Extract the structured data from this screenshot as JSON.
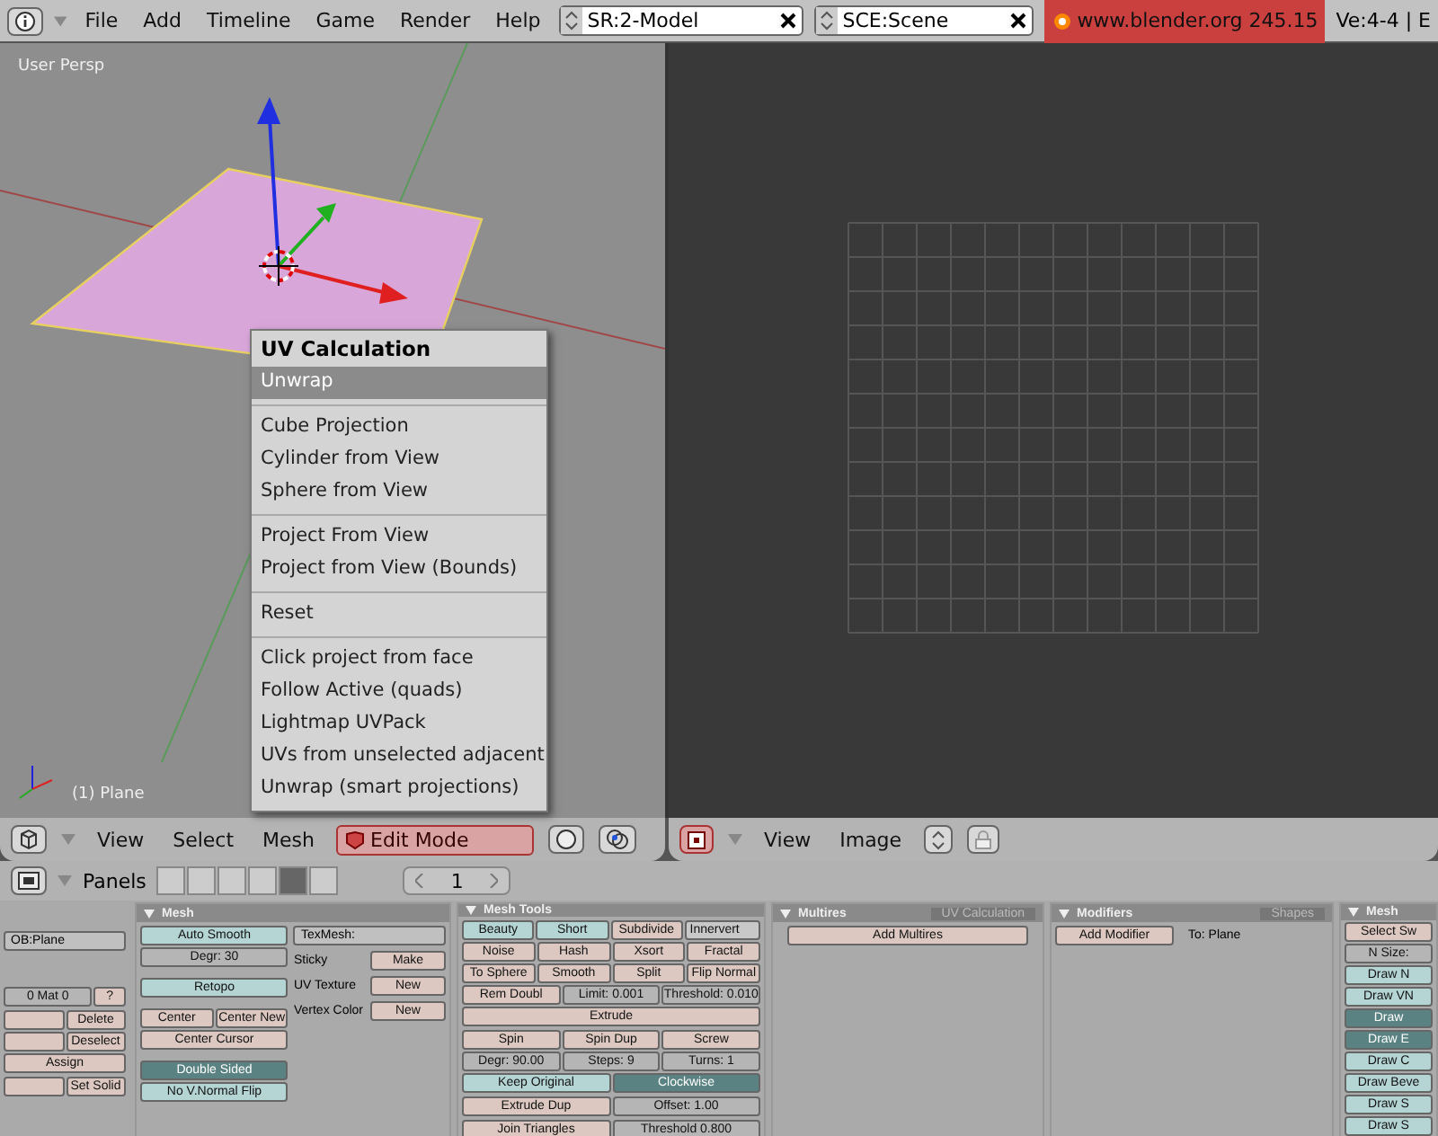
{
  "top_bar": {
    "menus": [
      "File",
      "Add",
      "Timeline",
      "Game",
      "Render",
      "Help"
    ],
    "screen": "SR:2-Model",
    "scene": "SCE:Scene",
    "version": "www.blender.org 245.15",
    "stats": "Ve:4-4 | E"
  },
  "viewport_3d": {
    "view_label": "User Persp",
    "object_label": "(1) Plane"
  },
  "uv_menu": {
    "title": "UV Calculation",
    "groups": [
      [
        {
          "label": "Unwrap",
          "selected": true
        }
      ],
      [
        {
          "label": "Cube Projection",
          "selected": false
        },
        {
          "label": "Cylinder from View",
          "selected": false
        },
        {
          "label": "Sphere from View",
          "selected": false
        }
      ],
      [
        {
          "label": "Project From View",
          "selected": false
        },
        {
          "label": "Project from View (Bounds)",
          "selected": false
        }
      ],
      [
        {
          "label": "Reset",
          "selected": false
        }
      ],
      [
        {
          "label": "Click project from face",
          "selected": false
        },
        {
          "label": "Follow Active (quads)",
          "selected": false
        },
        {
          "label": "Lightmap UVPack",
          "selected": false
        },
        {
          "label": "UVs from unselected adjacent",
          "selected": false
        },
        {
          "label": "Unwrap (smart projections)",
          "selected": false
        }
      ]
    ]
  },
  "header_3d": {
    "menus": [
      "View",
      "Select",
      "Mesh"
    ],
    "mode": "Edit Mode"
  },
  "header_uv": {
    "menus": [
      "View",
      "Image"
    ]
  },
  "buttons_header": {
    "label": "Panels",
    "context_tabs": [
      {
        "selected": false
      },
      {
        "selected": false
      },
      {
        "selected": false
      },
      {
        "selected": false
      },
      {
        "selected": true
      },
      {
        "selected": false
      }
    ],
    "frame": "1"
  },
  "link_panel": {
    "object": "OB:Plane",
    "material": "0 Mat 0",
    "help": "?",
    "groups": [
      [
        [
          {
            "kind": "action"
          },
          {
            "kind": "action",
            "label": "Delete"
          }
        ],
        [
          {
            "kind": "action"
          },
          {
            "kind": "action",
            "label": "Deselect"
          }
        ],
        [
          {
            "kind": "action",
            "label": "Assign"
          }
        ]
      ],
      [
        [
          {
            "kind": "action"
          },
          {
            "kind": "action",
            "label": "Set Solid"
          }
        ]
      ]
    ]
  },
  "mesh_panel": {
    "title": "Mesh",
    "groups": [
      [
        [
          {
            "kind": "toggle",
            "label": "Auto Smooth",
            "on": false
          }
        ],
        [
          {
            "kind": "number",
            "label": "Degr: 30"
          }
        ]
      ],
      [
        [
          {
            "kind": "toggle",
            "label": "Retopo",
            "on": false
          }
        ]
      ],
      [
        [
          {
            "kind": "action",
            "label": "Center"
          },
          {
            "kind": "action",
            "label": "Center New"
          }
        ],
        [
          {
            "kind": "action",
            "label": "Center Cursor"
          }
        ]
      ],
      [
        [
          {
            "kind": "toggle",
            "label": "Double Sided",
            "on": true
          }
        ],
        [
          {
            "kind": "toggle",
            "label": "No V.Normal Flip",
            "on": false
          }
        ]
      ]
    ],
    "texmesh": "TexMesh:",
    "layers": [
      {
        "label": "Sticky",
        "button": "Make"
      },
      {
        "label": "UV Texture",
        "button": "New"
      },
      {
        "label": "Vertex Color",
        "button": "New"
      }
    ]
  },
  "mesh_tools_panel": {
    "title": "Mesh Tools",
    "groups": [
      [
        [
          {
            "kind": "toggle",
            "label": "Beauty",
            "on": false
          },
          {
            "kind": "toggle",
            "label": "Short",
            "on": false
          },
          {
            "kind": "action",
            "label": "Subdivide"
          },
          {
            "kind": "menu",
            "label": "Innervert"
          }
        ],
        [
          {
            "kind": "action",
            "label": "Noise"
          },
          {
            "kind": "action",
            "label": "Hash"
          },
          {
            "kind": "action",
            "label": "Xsort"
          },
          {
            "kind": "action",
            "label": "Fractal"
          }
        ],
        [
          {
            "kind": "action",
            "label": "To Sphere"
          },
          {
            "kind": "action",
            "label": "Smooth"
          },
          {
            "kind": "action",
            "label": "Split"
          },
          {
            "kind": "action",
            "label": "Flip Normal"
          }
        ],
        [
          {
            "kind": "action",
            "label": "Rem Doubl"
          },
          {
            "kind": "number",
            "label": "Limit: 0.001"
          },
          {
            "kind": "number",
            "label": "Threshold: 0.010"
          }
        ],
        [
          {
            "kind": "action",
            "label": "Extrude"
          }
        ]
      ],
      [
        [
          {
            "kind": "action",
            "label": "Spin"
          },
          {
            "kind": "action",
            "label": "Spin Dup"
          },
          {
            "kind": "action",
            "label": "Screw"
          }
        ],
        [
          {
            "kind": "number",
            "label": "Degr: 90.00"
          },
          {
            "kind": "number",
            "label": "Steps: 9"
          },
          {
            "kind": "number",
            "label": "Turns: 1"
          }
        ],
        [
          {
            "kind": "toggle",
            "label": "Keep Original",
            "on": false
          },
          {
            "kind": "toggle",
            "label": "Clockwise",
            "on": true
          }
        ]
      ],
      [
        [
          {
            "kind": "action",
            "label": "Extrude Dup"
          },
          {
            "kind": "number",
            "label": "Offset: 1.00"
          }
        ]
      ],
      [
        [
          {
            "kind": "action",
            "label": "Join Triangles"
          },
          {
            "kind": "number",
            "label": "Threshold 0.800"
          }
        ]
      ]
    ]
  },
  "multires_panel": {
    "title": "Multires",
    "tab": "UV Calculation",
    "button": "Add Multires"
  },
  "modifiers_panel": {
    "title": "Modifiers",
    "tab": "Shapes",
    "button": "Add Modifier",
    "target": "To: Plane"
  },
  "mesh_panel_2": {
    "title": "Mesh",
    "groups": [
      [
        [
          {
            "kind": "action",
            "label": "Select Sw"
          }
        ]
      ],
      [
        [
          {
            "kind": "number",
            "label": "N Size:"
          }
        ],
        [
          {
            "kind": "toggle",
            "label": "Draw N",
            "on": false
          }
        ],
        [
          {
            "kind": "toggle",
            "label": "Draw VN",
            "on": false
          }
        ]
      ],
      [
        [
          {
            "kind": "toggle",
            "label": "Draw",
            "on": true
          }
        ],
        [
          {
            "kind": "toggle",
            "label": "Draw E",
            "on": true
          }
        ],
        [
          {
            "kind": "toggle",
            "label": "Draw C",
            "on": false
          }
        ],
        [
          {
            "kind": "toggle",
            "label": "Draw Beve",
            "on": false
          }
        ],
        [
          {
            "kind": "toggle",
            "label": "Draw S",
            "on": false
          }
        ],
        [
          {
            "kind": "toggle",
            "label": "Draw S",
            "on": false
          }
        ]
      ]
    ]
  }
}
